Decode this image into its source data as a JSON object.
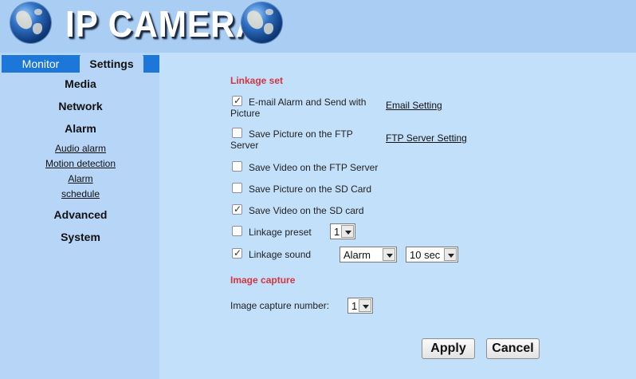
{
  "header": {
    "title": "IP CAMERA"
  },
  "tabs": {
    "monitor": "Monitor",
    "settings": "Settings"
  },
  "sidebar": {
    "media": "Media",
    "network": "Network",
    "alarm": "Alarm",
    "audio_alarm": "Audio alarm",
    "motion_detection": "Motion detection",
    "alarm_sub": "Alarm",
    "schedule": "schedule",
    "advanced": "Advanced",
    "system": "System"
  },
  "linkage": {
    "title": "Linkage set",
    "email_line1": "E-mail Alarm and Send with",
    "email_line2": "Picture",
    "email_checked": true,
    "email_setting_link": "Email Setting",
    "ftp_pic_line1": "Save Picture on the FTP",
    "ftp_pic_line2": "Server",
    "ftp_pic_checked": false,
    "ftp_setting_link": "FTP Server Setting",
    "ftp_video": "Save Video on the FTP Server",
    "ftp_video_checked": false,
    "sd_picture": "Save Picture on the SD Card",
    "sd_picture_checked": false,
    "sd_video": "Save Video on the SD card",
    "sd_video_checked": true,
    "preset_label": "Linkage preset",
    "preset_checked": false,
    "preset_value": "1",
    "sound_label": "Linkage sound",
    "sound_checked": true,
    "sound_value": "Alarm",
    "sound_duration": "10 sec"
  },
  "capture": {
    "title": "Image capture",
    "number_label": "Image capture number:",
    "number_value": "1"
  },
  "buttons": {
    "apply": "Apply",
    "cancel": "Cancel"
  },
  "colors": {
    "accent": "#1c77d8",
    "section_title": "#d1363f",
    "page_bg": "#b7d6f7",
    "content_bg": "#c3e0fa"
  }
}
